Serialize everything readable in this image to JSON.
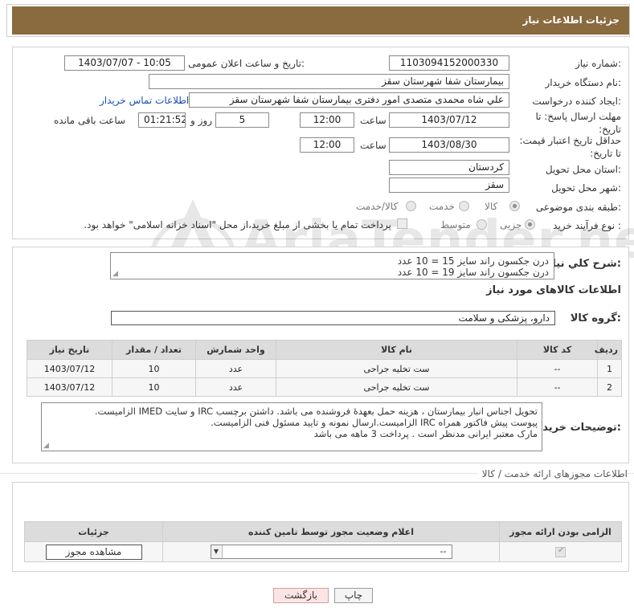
{
  "header": {
    "title": "جزئیات اطلاعات نیاز"
  },
  "form": {
    "need_number_label": "شماره نیاز:",
    "need_number": "1103094152000330",
    "announce_label": "تاریخ و ساعت اعلان عمومی:",
    "announce_value": "1403/07/07 - 10:05",
    "buyer_label": "نام دستگاه خریدار:",
    "buyer_value": "بیمارستان شفا شهرستان سقز",
    "creator_label": "ایجاد کننده درخواست:",
    "creator_value": "علي شاه محمدی متصدی امور دفتری بیمارستان شفا شهرستان سقز",
    "contact_link": "اطلاعات تماس خریدار",
    "deadline_label": "مهلت ارسال پاسخ: تا تاریخ:",
    "deadline_date": "1403/07/12",
    "time_label": "ساعت",
    "deadline_time": "12:00",
    "days_value": "5",
    "days_label": "روز و",
    "remaining_value": "01:21:52",
    "remaining_label": "ساعت باقی مانده",
    "price_validity_label": "حداقل تاریخ اعتبار قیمت: تا تاریخ:",
    "price_validity_date": "1403/08/30",
    "price_validity_time": "12:00",
    "province_label": "استان محل تحویل:",
    "province_value": "کردستان",
    "city_label": "شهر محل تحویل:",
    "city_value": "سقز",
    "category_label": "طبقه بندی موضوعی:",
    "category_options": [
      "کالا",
      "خدمت",
      "کالا/خدمت"
    ],
    "process_label": "نوع فرآیند خرید :",
    "process_options": [
      "جزیی",
      "متوسط"
    ],
    "payment_note": "پرداخت تمام یا بخشی از مبلغ خرید،از محل \"اسناد خزانه اسلامی\" خواهد بود."
  },
  "summary": {
    "label": "شرح كلي نياز:",
    "lines": [
      "درن جکسون راند سایز 15 = 10 عدد",
      "درن جکسون راند سایز 19 = 10 عدد"
    ]
  },
  "goods": {
    "section_title": "اطلاعات کالاهای مورد نیاز",
    "group_label": "گروه کالا:",
    "group_value": "دارو، پزشکی و سلامت",
    "columns": [
      "ردیف",
      "کد کالا",
      "نام کالا",
      "واحد شمارش",
      "تعداد / مقدار",
      "تاریخ نیاز"
    ],
    "rows": [
      [
        "1",
        "--",
        "ست تخلیه جراحی",
        "عدد",
        "10",
        "1403/07/12"
      ],
      [
        "2",
        "--",
        "ست تخلیه جراحی",
        "عدد",
        "10",
        "1403/07/12"
      ]
    ]
  },
  "notes": {
    "label": "توضیحات خریدار:",
    "lines": [
      "تحویل اجناس  انبار بیمارستان ، هزینه حمل بعهدۀ فروشنده می باشد.  داشتن برچسب IRC  و سایت  IMED  الزامیست.",
      "پیوست پیش فاکتور همراه IRC  الزامیست.ارسال نمونه و تایید مسئول فنی الزامیست.",
      "مارک معتبر ایرانی مدنظر است . پرداخت 3 ماهه می باشد"
    ]
  },
  "permits": {
    "section_title": "اطلاعات مجوزهای ارائه خدمت / کالا",
    "columns": [
      "الزامی بودن ارائه مجوز",
      "اعلام وضعیت مجوز توسط تامین کننده",
      "جزئیات"
    ],
    "select_value": "--",
    "view_button": "مشاهده مجوز"
  },
  "footer": {
    "print_button": "چاپ",
    "back_button": "بازگشت"
  },
  "watermark": {
    "text": "AriaTender.neT"
  },
  "colors": {
    "header_bg": "#8a6a3f",
    "link": "#1a4fb5",
    "back_btn_bg": "#fde4e4"
  }
}
